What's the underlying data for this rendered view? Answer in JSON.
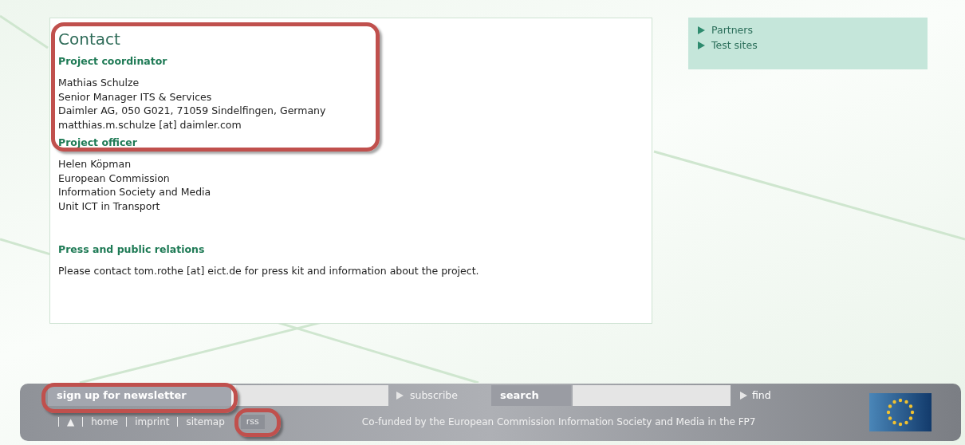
{
  "main": {
    "title": "Contact",
    "highlighted": true,
    "sections": [
      {
        "heading": "Project coordinator",
        "lines": [
          "Mathias Schulze",
          "Senior Manager ITS & Services",
          "Daimler AG, 050 G021, 71059 Sindelfingen, Germany",
          "matthias.m.schulze [at] daimler.com"
        ]
      },
      {
        "heading": "Project officer",
        "lines": [
          "Helen Köpman",
          "European Commission",
          "Information Society and Media",
          "Unit ICT in Transport"
        ]
      },
      {
        "heading": "Press and public relations",
        "lines": [
          "Please contact tom.rothe [at] eict.de for press kit and information about the project."
        ]
      }
    ]
  },
  "sidebar": {
    "items": [
      "Partners",
      "Test sites"
    ]
  },
  "footer": {
    "newsletter": {
      "label": "sign up for newsletter",
      "button": "subscribe",
      "highlighted": true
    },
    "search": {
      "label": "search",
      "button": "find"
    },
    "links": [
      {
        "label": "▲",
        "highlighted": false
      },
      {
        "label": "home",
        "highlighted": false
      },
      {
        "label": "imprint",
        "highlighted": false
      },
      {
        "label": "sitemap",
        "highlighted": false
      },
      {
        "label": "rss",
        "highlighted": true
      }
    ],
    "cofunded": "Co-funded by the European Commission Information Society and Media in the FP7"
  }
}
